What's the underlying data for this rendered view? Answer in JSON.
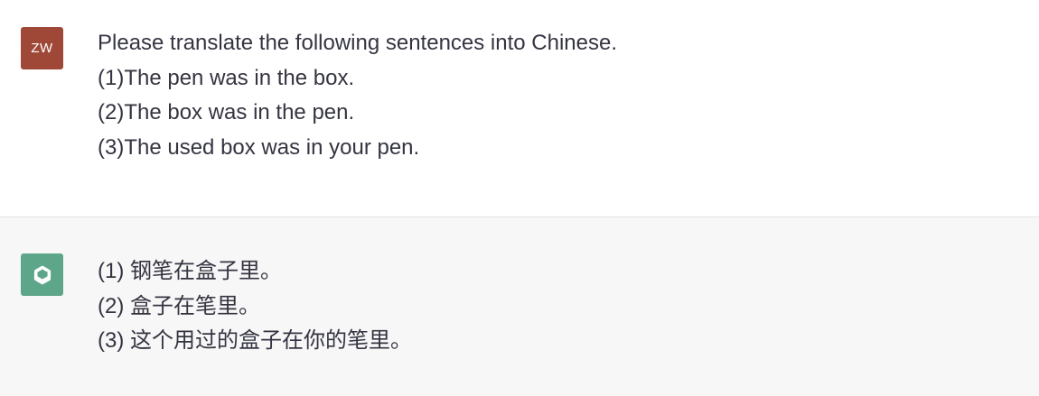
{
  "conversation": {
    "user": {
      "avatar_initials": "ZW",
      "lines": [
        "Please translate the following sentences into Chinese.",
        "(1)The pen was in the box.",
        "(2)The box was in the pen.",
        "(3)The used box was in your pen."
      ]
    },
    "assistant": {
      "avatar_icon": "openai-logo-icon",
      "lines": [
        "(1) 钢笔在盒子里。",
        "(2) 盒子在笔里。",
        "(3) 这个用过的盒子在你的笔里。"
      ]
    }
  },
  "colors": {
    "user_avatar_bg": "#a04838",
    "assistant_avatar_bg": "#5ea68a",
    "assistant_row_bg": "#f7f7f8",
    "text": "#343541"
  }
}
